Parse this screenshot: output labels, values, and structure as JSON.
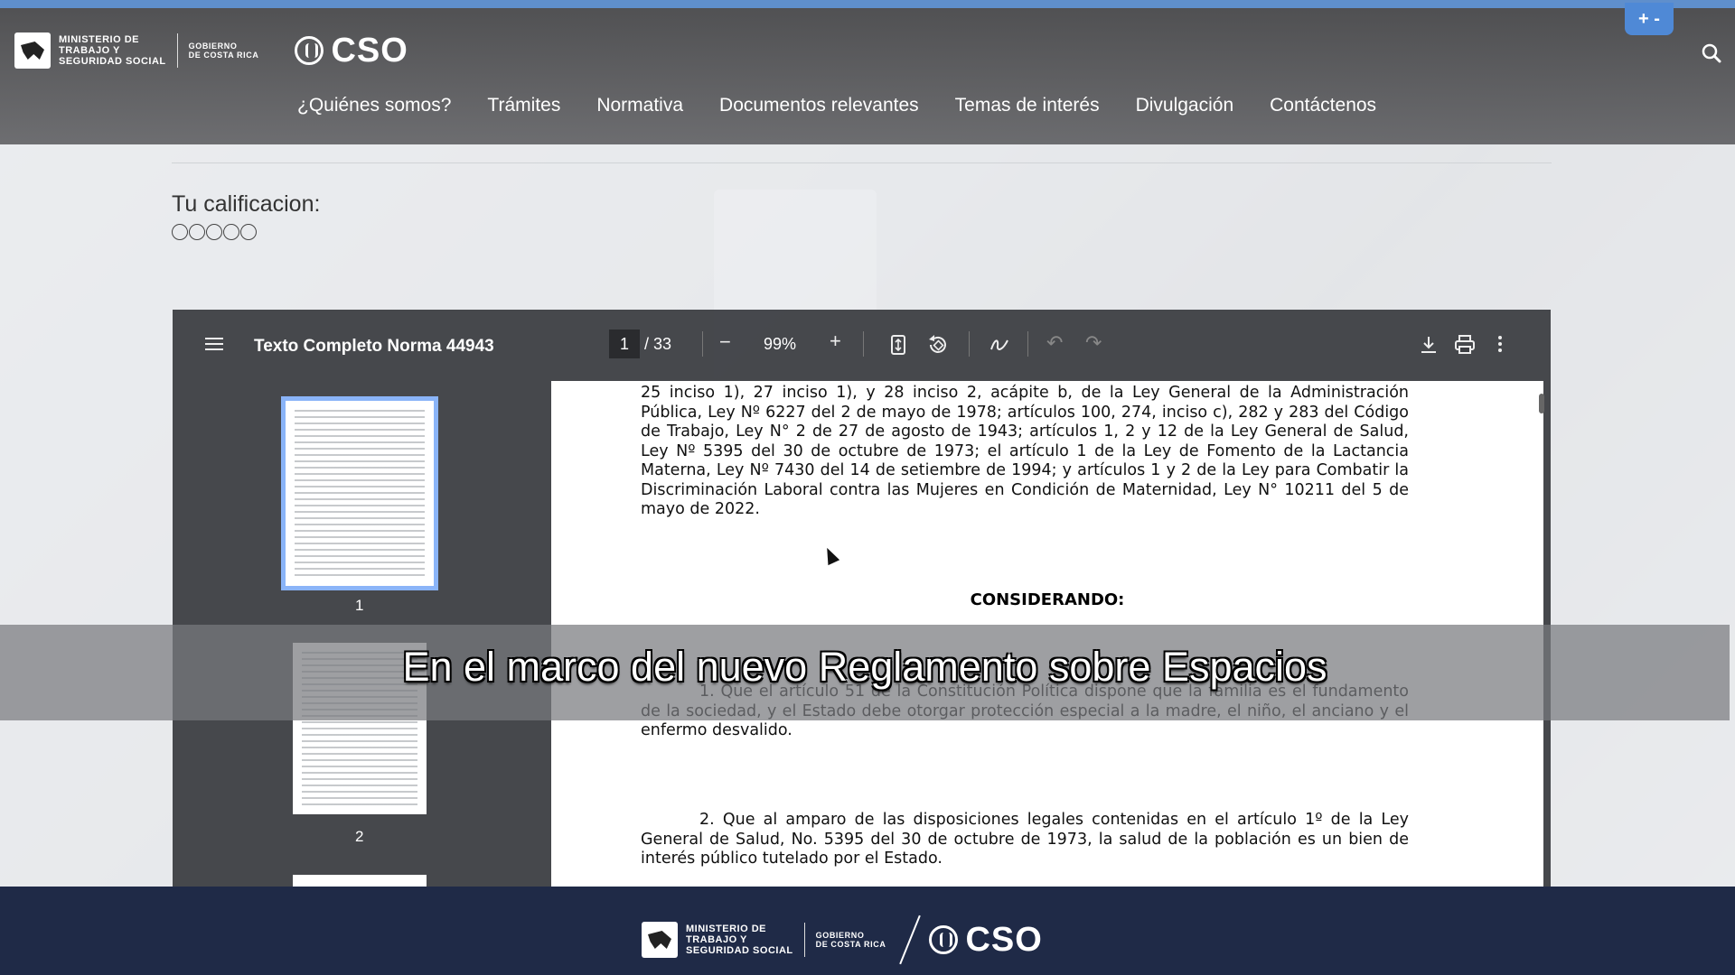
{
  "header": {
    "ministry": "MINISTERIO DE\nTRABAJO Y\nSEGURIDAD SOCIAL",
    "government": "GOBIERNO\nDE COSTA RICA",
    "brand": "CSO",
    "zoom_controls": "+ -",
    "nav": [
      "¿Quiénes somos?",
      "Trámites",
      "Normativa",
      "Documentos relevantes",
      "Temas de interés",
      "Divulgación",
      "Contáctenos"
    ]
  },
  "rating": {
    "label": "Tu calificacion:",
    "stars_total": 5,
    "stars_selected": 0
  },
  "viewer": {
    "title": "Texto Completo Norma 44943",
    "current_page": "1",
    "total_pages": "/ 33",
    "zoom": "99%",
    "thumbnails": [
      "1",
      "2"
    ],
    "content": {
      "p1": "25 inciso 1), 27 inciso 1), y 28 inciso 2, acápite b, de la Ley General de la Administración Pública, Ley Nº 6227 del 2 de mayo de 1978; artículos 100, 274, inciso c), 282 y 283 del Código de Trabajo, Ley N° 2 de 27 de agosto de 1943; artículos 1, 2 y 12 de la Ley General de Salud, Ley Nº 5395 del 30 de octubre de 1973; el artículo 1 de la Ley de Fomento de la Lactancia Materna, Ley Nº 7430 del 14 de setiembre de 1994; y artículos 1 y 2 de la Ley para Combatir la Discriminación Laboral contra las Mujeres en Condición de Maternidad, Ley N° 10211 del 5 de mayo de 2022.",
      "heading": "CONSIDERANDO:",
      "p2": "1. Que el artículo 51 de la Constitución Política dispone que la familia es el fundamento de la sociedad, y el Estado debe otorgar protección especial a la madre, el niño, el anciano y el enfermo desvalido.",
      "p3": "2. Que al amparo de las disposiciones legales contenidas en el artículo 1º de la Ley General de Salud, No. 5395 del 30 de octubre de 1973, la salud de la población es un bien de interés público tutelado por el Estado."
    }
  },
  "subtitle": "En el marco del nuevo Reglamento sobre Espacios",
  "footer": {
    "ministry": "MINISTERIO DE\nTRABAJO Y\nSEGURIDAD SOCIAL",
    "government": "GOBIERNO\nDE COSTA RICA",
    "brand": "CSO"
  }
}
